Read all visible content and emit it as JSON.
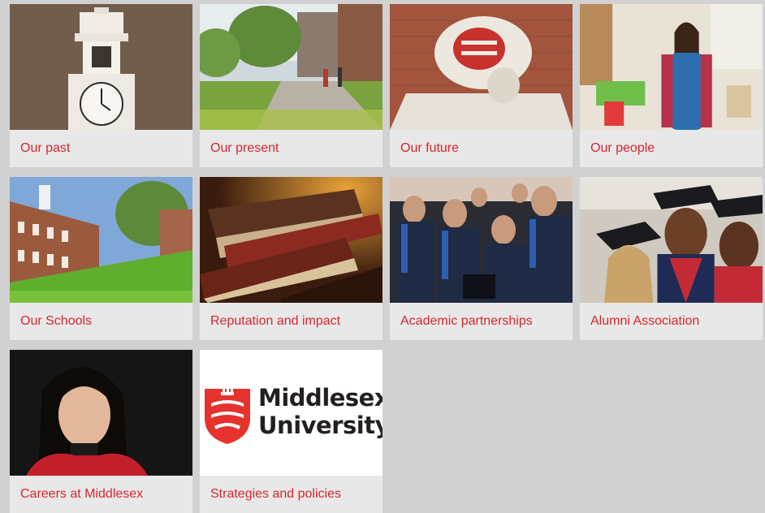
{
  "tiles": [
    {
      "label": "Our past",
      "image": "clock-tower-photo"
    },
    {
      "label": "Our present",
      "image": "campus-lawn-photo"
    },
    {
      "label": "Our future",
      "image": "crest-sculpture-photo"
    },
    {
      "label": "Our people",
      "image": "teacher-classroom-photo"
    },
    {
      "label": "Our Schools",
      "image": "campus-building-photo"
    },
    {
      "label": "Reputation and impact",
      "image": "old-books-photo"
    },
    {
      "label": "Academic partnerships",
      "image": "graduates-seated-photo"
    },
    {
      "label": "Alumni Association",
      "image": "smiling-graduates-photo"
    },
    {
      "label": "Careers at Middlesex",
      "image": "woman-portrait-photo"
    },
    {
      "label": "Strategies and policies",
      "image": "middlesex-logo"
    }
  ],
  "logo": {
    "line1": "Middlesex",
    "line2": "University"
  },
  "colors": {
    "accent": "#d7262f",
    "tile_bg": "#e8e8e8",
    "page_bg": "#d1d1d1"
  }
}
